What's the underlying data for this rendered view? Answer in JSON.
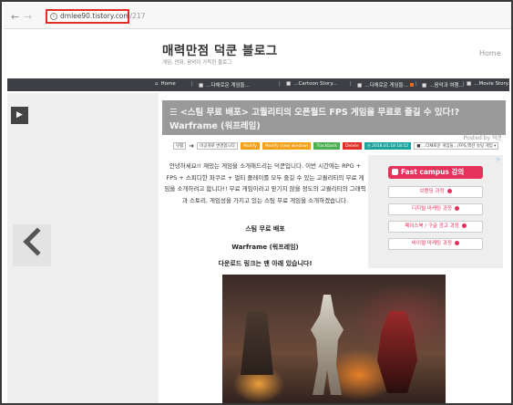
{
  "browser": {
    "back_glyph": "←",
    "forward_glyph": "→",
    "url_host": "dmlee90.tistory.com",
    "url_path": "/217",
    "info_glyph": "i"
  },
  "blog": {
    "title": "매력만점 덕쿤 블로그",
    "subtitle": "게임, 만화, 음악이 가득한 블로그",
    "home_label": "Home"
  },
  "nav": {
    "items": [
      {
        "label": "Home",
        "icon": "home-icon",
        "glyph": "⌂"
      },
      {
        "label": "...다채로운 게임들...",
        "icon": "folder-icon",
        "glyph": "■"
      },
      {
        "label": "...Cartoon Story...",
        "icon": "folder-icon",
        "glyph": "■"
      },
      {
        "label": "...다채로운 게임들...",
        "icon": "folder-icon",
        "glyph": "■"
      },
      {
        "label": "...음악과 여행...",
        "icon": "folder-icon",
        "glyph": "■"
      },
      {
        "label": "...Movie Story...",
        "icon": "folder-icon",
        "glyph": "■"
      }
    ],
    "separator": "|",
    "badge_color": "#e26c1b"
  },
  "rail": {
    "toggle_glyph": "▶"
  },
  "post": {
    "title": "☰ <스팀 무료 배포> 고퀄리티의 오픈월드 FPS 게임을 무료로 즐길 수 있다!? Warframe (워프레임)",
    "posted_by": "Posted by 덕쿤",
    "tags": [
      {
        "label": "덧펌",
        "style": "plain"
      },
      {
        "label": "비공개로 변경합니다",
        "style": "plain"
      },
      {
        "label": "Modify",
        "style": "orange"
      },
      {
        "label": "Modify (new window)",
        "style": "orange"
      },
      {
        "label": "Trackback",
        "style": "green"
      },
      {
        "label": "Delete",
        "style": "red"
      },
      {
        "label": "◷ 2018.01.18 18:52",
        "style": "teal"
      },
      {
        "label": "■ ...다채로운 게임들.../FPS,액션 슈팅 게임 ▾",
        "style": "plain"
      }
    ],
    "intro": "안녕하세요!! 재밌는 게임을 소개해드리는 덕쿤입니다. 이번 시간에는 RPG + FPS + 스피디한 파쿠르 + 멀티 플레이를 모두 즐길 수 있는 고퀄리티의 무료 게임을 소개하려고 합니다!! 무료 게임이라고 믿기지 않을 정도의 고퀄리티의 그래픽과 스토리, 게임성을 가지고 있는 스팀 무료 게임을 소개하겠습니다.",
    "line_free": "스팀 무료 배포",
    "line_game": "Warframe (워프레임)",
    "line_download": "다운로드 링크는 맨 아래 있습니다!"
  },
  "ad": {
    "brand": "Fast campus 강의",
    "close_label": "▷",
    "items": [
      "브랜딩 과정",
      "디지털 마케팅 과정",
      "페이스북 / 구글 광고 과정",
      "바이럴 마케팅 과정"
    ],
    "accent": "#e5325c"
  },
  "colors": {
    "nav_bg": "#3d3f44",
    "title_bg": "#9a9a9a",
    "url_border": "#e0302a"
  }
}
